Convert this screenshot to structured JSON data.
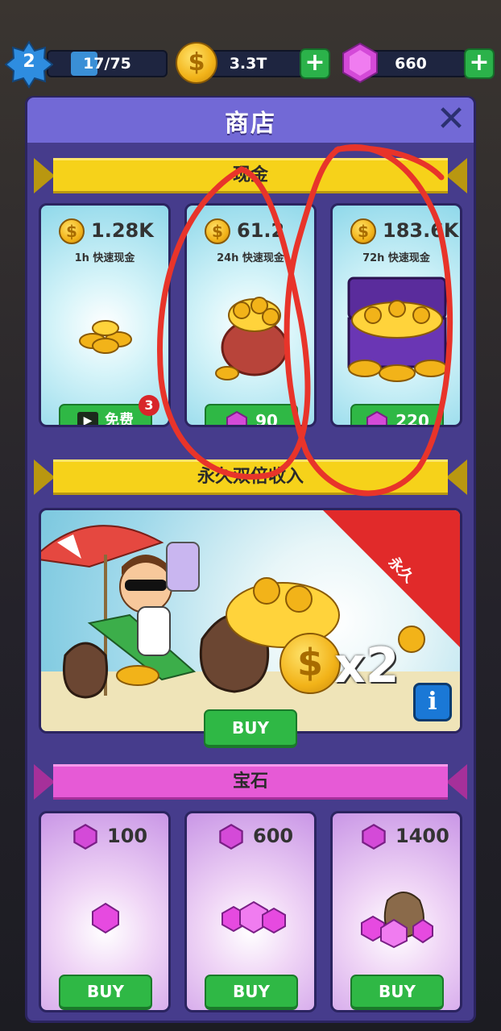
{
  "hud": {
    "level": "2",
    "xp_text": "17/75",
    "xp_fraction": 0.227,
    "coins": "3.3T",
    "gems": "660"
  },
  "panel": {
    "title": "商店",
    "sections": {
      "cash": {
        "title": "现金"
      },
      "double": {
        "title": "永久双倍收入"
      },
      "gems": {
        "title": "宝石"
      }
    }
  },
  "cash_offers": [
    {
      "amount": "1.28K",
      "duration": "1h 快速现金",
      "button": "免费",
      "badge": "3"
    },
    {
      "amount": "61.2",
      "duration": "24h 快速现金",
      "button": "90"
    },
    {
      "amount": "183.6K",
      "duration": "72h 快速现金",
      "button": "220"
    }
  ],
  "double_offer": {
    "tag": "永久",
    "multiplier": "x2",
    "button": "BUY"
  },
  "gem_offers": [
    {
      "amount": "100",
      "button": "BUY"
    },
    {
      "amount": "600",
      "button": "BUY"
    },
    {
      "amount": "1400",
      "button": "BUY"
    }
  ],
  "colors": {
    "panel": "#463c8c",
    "header": "#7269d6",
    "ribbon_yellow": "#f6d21a",
    "ribbon_pink": "#e65ad6",
    "button_green": "#2fb845",
    "scribble_red": "#e8342a"
  }
}
